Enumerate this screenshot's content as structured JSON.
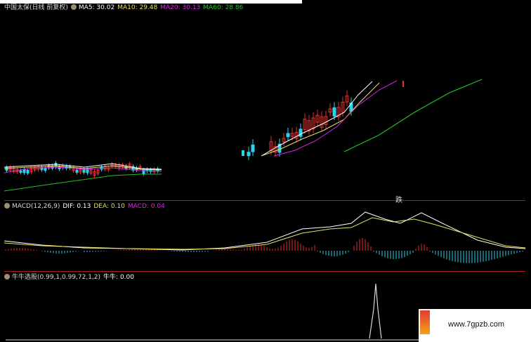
{
  "main_header": {
    "stock_name": "中国太保(日线 前复权)",
    "ma5": "MA5: 30.02",
    "ma10": "MA10: 29.48",
    "ma20": "MA20: 30.13",
    "ma60": "MA60: 28.86"
  },
  "macd_header": {
    "name": "MACD(12,26,9)",
    "dif": "DIF: 0.13",
    "dea": "DEA: 0.10",
    "macd": "MACD: 0.04"
  },
  "niu_header": {
    "name": "牛牛选股(0.99,1,0.99,72,1,2)",
    "value": "牛牛: 0.00"
  },
  "die_label": "跌",
  "watermark": "www.7gpzb.com",
  "colors": {
    "ma5": "#ffffff",
    "ma10": "#e8e061",
    "ma20": "#e020e0",
    "ma60": "#22c022",
    "up": "#e03030",
    "down": "#2ad4f0",
    "separator": "#a61f1f"
  }
}
